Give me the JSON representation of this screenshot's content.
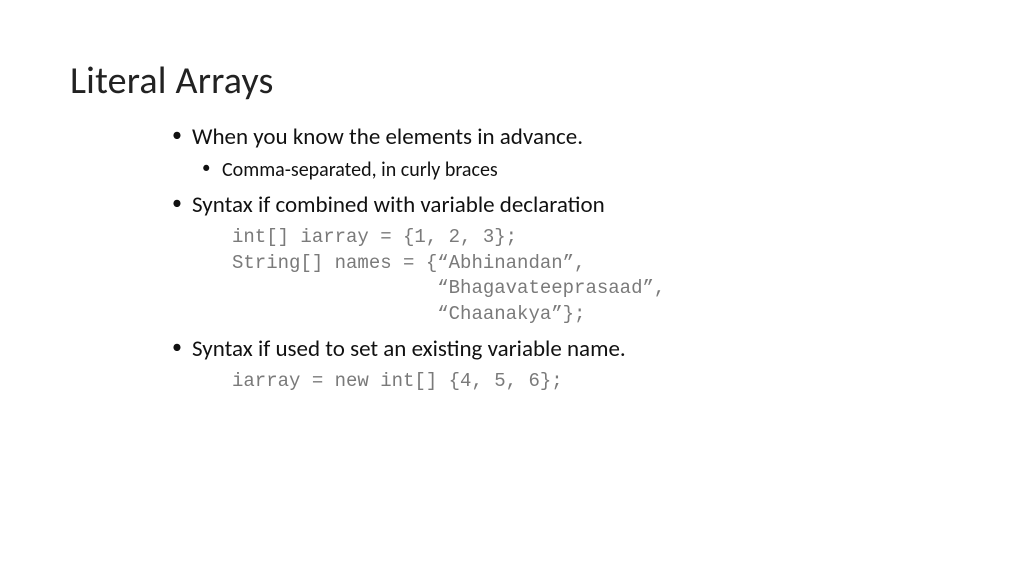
{
  "title": "Literal Arrays",
  "bullets": {
    "b1": "When you know the elements in advance.",
    "b1a": "Comma-separated, in curly braces",
    "b2": "Syntax if combined with variable declaration",
    "code1": "int[] iarray = {1, 2, 3};\nString[] names = {“Abhinandan”,\n                  “Bhagavateeprasaad”,\n                  “Chaanakya”};",
    "b3": "Syntax if used to set an existing variable name.",
    "code2": "iarray = new int[] {4, 5, 6};"
  }
}
